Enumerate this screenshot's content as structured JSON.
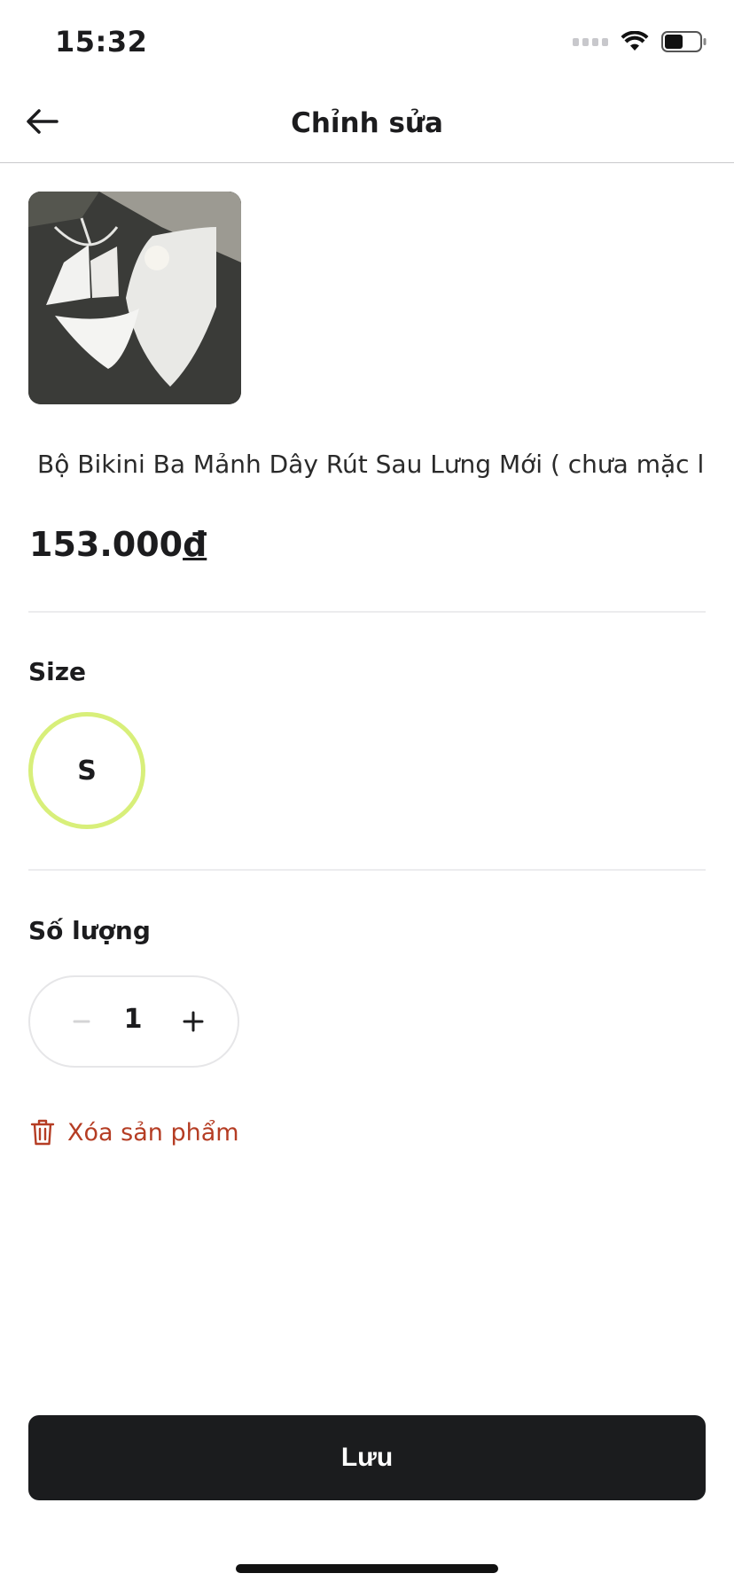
{
  "status_bar": {
    "time": "15:32"
  },
  "header": {
    "title": "Chỉnh sửa",
    "back_icon": "arrow-left-icon"
  },
  "product": {
    "name": "Bộ Bikini Ba Mảnh Dây Rút Sau Lưng Mới ( chưa mặc lần nào chưa khui )",
    "price_amount": "153.000",
    "price_currency": "đ"
  },
  "size": {
    "label": "Size",
    "selected": "S",
    "accent_color": "#d8ef7a"
  },
  "quantity": {
    "label": "Số lượng",
    "value": "1"
  },
  "delete": {
    "label": "Xóa sản phẩm",
    "icon": "trash-icon",
    "color": "#b53d24"
  },
  "save": {
    "label": "Lưu"
  }
}
